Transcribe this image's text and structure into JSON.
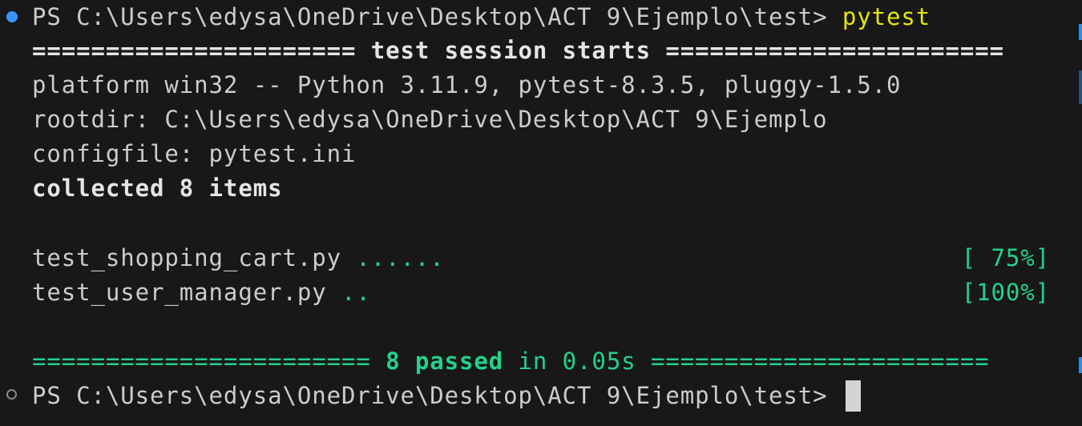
{
  "terminal": {
    "prompt": "PS C:\\Users\\edysa\\OneDrive\\Desktop\\ACT 9\\Ejemplo\\test> ",
    "command": "pytest",
    "session_header_left": "====================== ",
    "session_header_title": "test session starts",
    "session_header_right": " =======================",
    "platform": "platform win32 -- Python 3.11.9, pytest-8.3.5, pluggy-1.5.0",
    "rootdir": "rootdir: C:\\Users\\edysa\\OneDrive\\Desktop\\ACT 9\\Ejemplo",
    "configfile": "configfile: pytest.ini",
    "collected": "collected 8 items",
    "results": [
      {
        "file": "test_shopping_cart.py ",
        "dots": "......",
        "percent": "[ 75%]"
      },
      {
        "file": "test_user_manager.py ",
        "dots": "..",
        "percent": "[100%]"
      }
    ],
    "summary_left": "======================= ",
    "summary_passed": "8 passed",
    "summary_time": " in 0.05s ",
    "summary_right": "=======================",
    "prompt2": "PS C:\\Users\\edysa\\OneDrive\\Desktop\\ACT 9\\Ejemplo\\test> "
  },
  "colors": {
    "background": "#181818",
    "text": "#cccccc",
    "command": "#e5e510",
    "pass": "#23d18b",
    "decoration_success": "#3794ff"
  }
}
